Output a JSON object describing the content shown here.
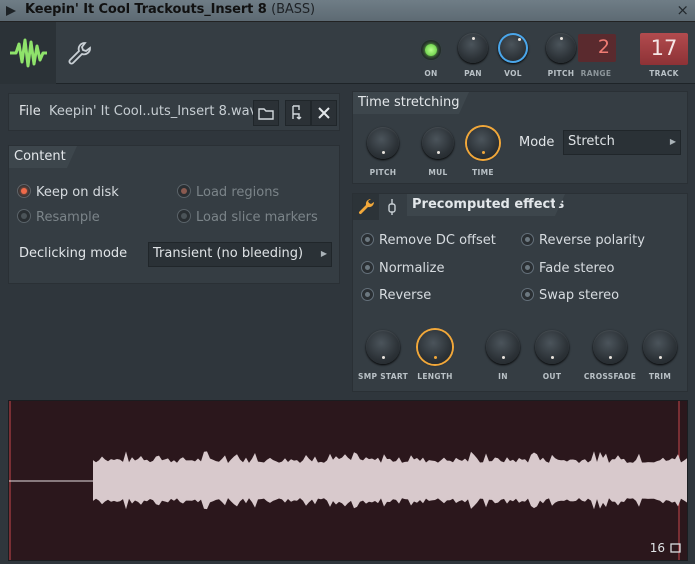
{
  "window": {
    "title": "Keepin' It Cool Trackouts_Insert 8",
    "subtitle": "(BASS)",
    "close_glyph": "×"
  },
  "toolbar": {
    "on_label": "ON",
    "pan_label": "PAN",
    "vol_label": "VOL",
    "pitch_label": "PITCH",
    "range_label": "RANGE",
    "range_value": "2",
    "track_label": "TRACK",
    "track_value": "17",
    "on_state": true,
    "vol_level": 0.78
  },
  "file": {
    "label": "File",
    "name": "Keepin' It Cool..uts_Insert 8.wav"
  },
  "content": {
    "header": "Content",
    "options": [
      {
        "label": "Keep on disk",
        "selected": true,
        "enabled": true
      },
      {
        "label": "Load regions",
        "selected": true,
        "enabled": false
      },
      {
        "label": "Resample",
        "selected": false,
        "enabled": false
      },
      {
        "label": "Load slice markers",
        "selected": false,
        "enabled": false
      }
    ],
    "declicking_label": "Declicking mode",
    "declicking_value": "Transient (no bleeding)"
  },
  "time_stretching": {
    "header": "Time stretching",
    "knobs": [
      "PITCH",
      "MUL",
      "TIME"
    ],
    "mode_label": "Mode",
    "mode_value": "Stretch"
  },
  "precomputed": {
    "header": "Precomputed effects",
    "effects_left": [
      "Remove DC offset",
      "Normalize",
      "Reverse"
    ],
    "effects_right": [
      "Reverse polarity",
      "Fade stereo",
      "Swap stereo"
    ],
    "knobs": [
      "SMP START",
      "LENGTH",
      "IN",
      "OUT",
      "CROSSFADE",
      "TRIM"
    ]
  },
  "waveform": {
    "zoom_label": "16"
  },
  "colors": {
    "accent_orange": "#f2a83a",
    "accent_green": "#8fe36b",
    "radio_on": "#f06a4a",
    "vol_ring": "#4aa6ea",
    "waveform_bg": "#2b171c",
    "waveform_fill": "#d8c9cc"
  },
  "icons": [
    "waveform-icon",
    "wrench-icon",
    "folder-icon",
    "file-browse-icon",
    "close-icon",
    "arrow-icon",
    "plug-icon",
    "loop-icon"
  ]
}
